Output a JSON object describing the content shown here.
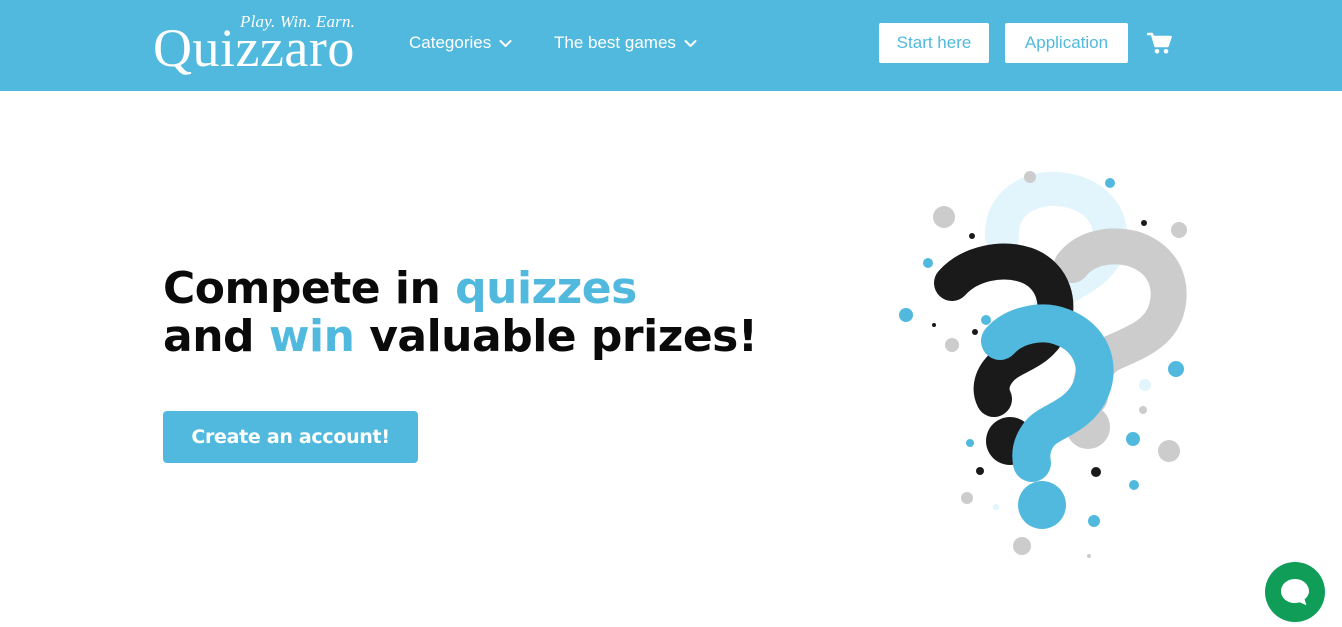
{
  "header": {
    "logo": {
      "tagline": "Play. Win. Earn.",
      "name": "Quizzaro"
    },
    "nav": [
      {
        "label": "Categories",
        "icon": "chevron-down-icon"
      },
      {
        "label": "The best games",
        "icon": "chevron-down-icon"
      }
    ],
    "buttons": {
      "start": "Start here",
      "application": "Application"
    },
    "cart_icon": "shopping-cart-icon"
  },
  "hero": {
    "line1_a": "Compete in ",
    "line1_b": "quizzes",
    "line2_a": "and ",
    "line2_b": "win",
    "line2_c": " valuable prizes!",
    "cta": "Create an account!"
  },
  "illustration": {
    "icon": "question-marks-illustration"
  },
  "chat": {
    "icon": "chat-bubble-icon"
  },
  "colors": {
    "brand": "#52b9de",
    "dark": "#0a0a0a",
    "light_gray": "#cccccc",
    "pale_blue": "#e2f5fc",
    "chat_green": "#0f9d58"
  }
}
